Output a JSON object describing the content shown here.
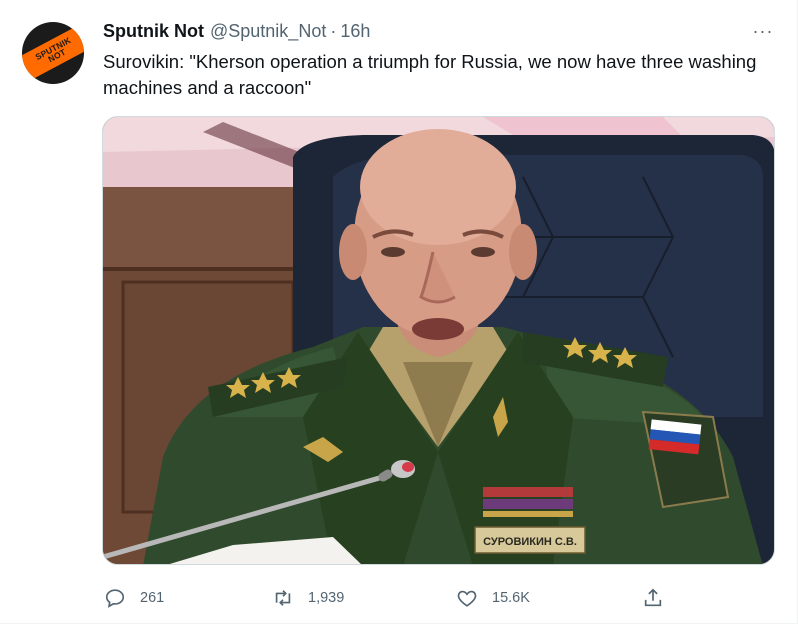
{
  "tweet": {
    "author_name": "Sputnik Not",
    "author_handle": "@Sputnik_Not",
    "separator": "·",
    "time": "16h",
    "more_icon": "···",
    "avatar_text": "SPUTNIK\nNOT",
    "text": "Surovikin: \"Kherson operation a triumph for Russia, we now have three washing machines and a raccoon\"",
    "media_name_tag": "СУРОВИКИН С.В."
  },
  "actions": {
    "reply": {
      "icon": "reply-icon",
      "count": "261"
    },
    "retweet": {
      "icon": "retweet-icon",
      "count": "1,939"
    },
    "like": {
      "icon": "like-icon",
      "count": "15.6K"
    },
    "share": {
      "icon": "share-icon"
    }
  },
  "colors": {
    "text": "#0f1419",
    "secondary": "#536471",
    "brand_orange": "#ff6b00",
    "uniform_green": "#2f4a2c"
  }
}
